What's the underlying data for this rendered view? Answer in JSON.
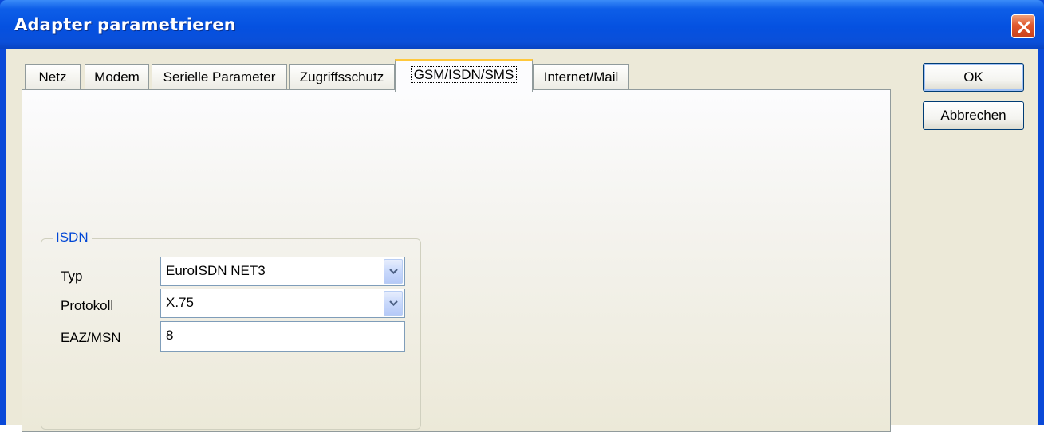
{
  "window": {
    "title": "Adapter parametrieren",
    "close_icon": "close-icon"
  },
  "tabs": [
    {
      "label": "Netz",
      "active": false
    },
    {
      "label": "Modem",
      "active": false
    },
    {
      "label": "Serielle Parameter",
      "active": false
    },
    {
      "label": "Zugriffsschutz",
      "active": false
    },
    {
      "label": "GSM/ISDN/SMS",
      "active": true
    },
    {
      "label": "Internet/Mail",
      "active": false
    }
  ],
  "isdn_group": {
    "title": "ISDN",
    "typ": {
      "label": "Typ",
      "value": "EuroISDN NET3"
    },
    "protokoll": {
      "label": "Protokoll",
      "value": "X.75"
    },
    "eaz_msn": {
      "label": "EAZ/MSN",
      "value": "8"
    }
  },
  "buttons": {
    "ok_label": "OK",
    "cancel_label": "Abbrechen"
  },
  "colors": {
    "titlebar": "#0551e0",
    "dialog_bg": "#ece9d8",
    "active_tab_highlight": "#ffc83c",
    "group_title": "#0046d5"
  }
}
